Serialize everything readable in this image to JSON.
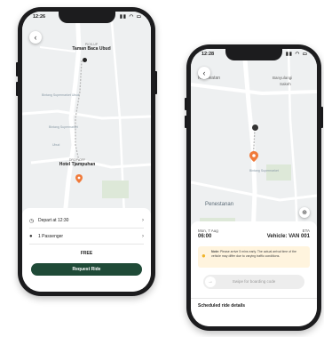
{
  "phone_left": {
    "status_time": "12:26",
    "pickup_caption": "PICK-UP",
    "pickup_name": "Taman Baca Ubud",
    "dropoff_caption": "DROP-OFF",
    "dropoff_name": "Hotel Tjampuhan",
    "map_labels": [
      "Bintang Supermarket Ubud",
      "Bintang Supermarket",
      "Ubud"
    ],
    "depart_label": "Depart at 12:30",
    "passenger_label": "1 Passenger",
    "price": "FREE",
    "request_button": "Request Ride"
  },
  "phone_right": {
    "status_time": "12:28",
    "map_labels": {
      "top_left": "Kedewatan",
      "top_right_1": "Banyulangi",
      "top_right_2": "Sakeh",
      "bottom": "Penestanan",
      "poi": "Bintang Supermarket"
    },
    "date": "Mon, 7 Aug",
    "time": "06:00",
    "eta_label": "ETA",
    "vehicle": "Vehicle: VAN 001",
    "note_bold": "Note:",
    "note_text": "Please arrive 5 mins early. The actual arrival time of the vehicle may differ due to varying traffic conditions.",
    "swipe_label": "Swipe for boarding code",
    "scheduled_label": "Scheduled ride details"
  },
  "colors": {
    "primary_green": "#1f4a37",
    "marker_orange": "#f07a3a",
    "note_bg": "#fff4de"
  }
}
